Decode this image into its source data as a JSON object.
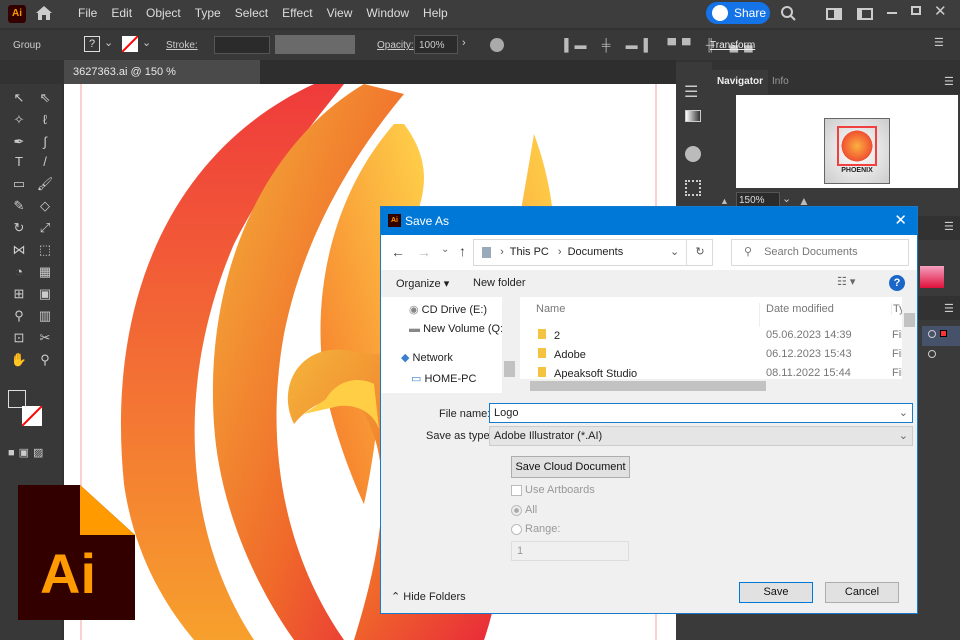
{
  "app": {
    "logo": "Ai",
    "menu": [
      "File",
      "Edit",
      "Object",
      "Type",
      "Select",
      "Effect",
      "View",
      "Window",
      "Help"
    ],
    "share_label": "Share"
  },
  "control": {
    "selection": "Group",
    "stroke_label": "Stroke:",
    "opacity_label": "Opacity:",
    "opacity_value": "100%",
    "transform_label": "Transform",
    "fill_unknown": "?"
  },
  "document": {
    "tab_title": "3627363.ai @ 150 % (RGB/Preview)"
  },
  "panels": {
    "tabs": [
      "Navigator",
      "Info"
    ],
    "zoom_value": "150%",
    "thumb_text": "PHOENIX"
  },
  "dialog": {
    "title": "Save As",
    "breadcrumb": [
      "This PC",
      "Documents"
    ],
    "search_placeholder": "Search Documents",
    "organize": "Organize",
    "new_folder": "New folder",
    "nav_items": [
      "CD Drive (E:)",
      "New Volume (Q:)",
      "Network",
      "HOME-PC"
    ],
    "columns": [
      "Name",
      "Date modified",
      "Ty"
    ],
    "files": [
      {
        "name": "2",
        "date": "05.06.2023 14:39",
        "type": "Fil"
      },
      {
        "name": "Adobe",
        "date": "06.12.2023 15:43",
        "type": "Fil"
      },
      {
        "name": "Apeaksoft Studio",
        "date": "08.11.2022 15:44",
        "type": "Fil"
      }
    ],
    "file_name_label": "File name:",
    "file_name_value": "Logo",
    "type_label": "Save as type:",
    "type_value": "Adobe Illustrator (*.AI)",
    "cloud_button": "Save Cloud Document",
    "use_artboards": "Use Artboards",
    "all_label": "All",
    "range_label": "Range:",
    "range_value": "1",
    "hide_folders": "Hide Folders",
    "save": "Save",
    "cancel": "Cancel"
  },
  "badge": {
    "logo_text": "Ai"
  },
  "colors": {
    "accent": "#0078d7",
    "share": "#1473e6",
    "ai_bg": "#330000",
    "ai_fg": "#ff9a00"
  }
}
